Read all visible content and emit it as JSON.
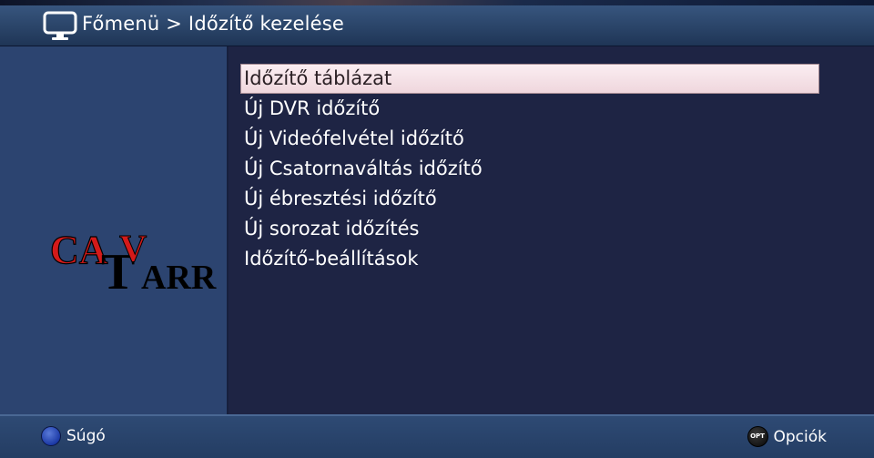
{
  "header": {
    "breadcrumb": "Főmenü > Időzítő kezelése"
  },
  "logo": {
    "text": "CATVTARR"
  },
  "menu": {
    "selected_index": 0,
    "items": [
      {
        "label": "Időzítő táblázat"
      },
      {
        "label": "Új DVR időzítő"
      },
      {
        "label": "Új Videófelvétel időzítő"
      },
      {
        "label": "Új Csatornaváltás időzítő"
      },
      {
        "label": "Új ébresztési időzítő"
      },
      {
        "label": "Új sorozat időzítés"
      },
      {
        "label": "Időzítő-beállítások"
      }
    ]
  },
  "footer": {
    "help_label": "Súgó",
    "options_label": "Opciók",
    "options_key": "OPT"
  },
  "colors": {
    "background": "#1e2444",
    "panel": "#2c4470",
    "selection": "#fbeef2",
    "logo_red": "#d41a1a",
    "logo_black": "#000000"
  }
}
